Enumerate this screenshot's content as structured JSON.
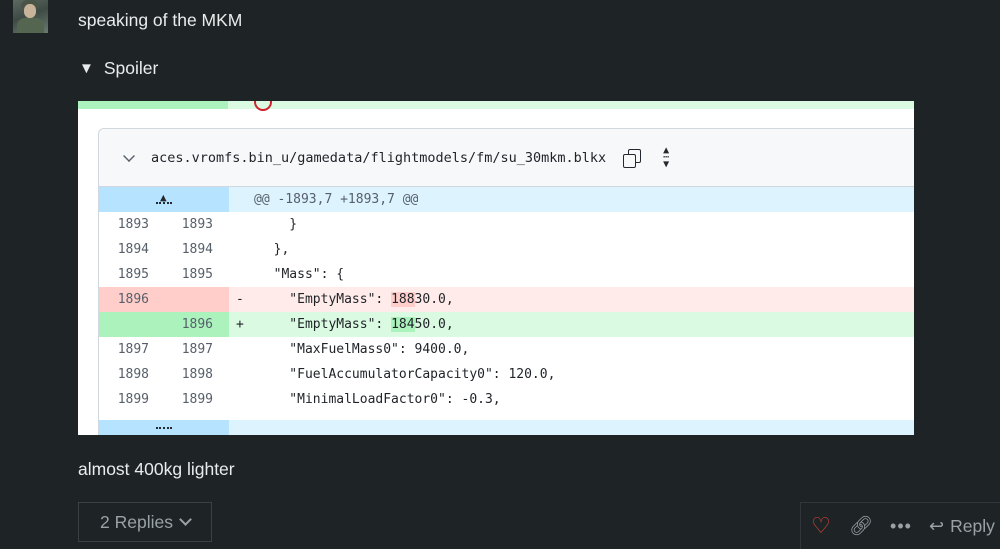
{
  "post": {
    "text1": "speaking of the MKM",
    "spoiler_label": "Spoiler",
    "text2": "almost 400kg lighter"
  },
  "diff": {
    "file_path": "aces.vromfs.bin_u/gamedata/flightmodels/fm/su_30mkm.blkx",
    "hunk_header": "@@ -1893,7 +1893,7 @@",
    "lines": [
      {
        "old": "1893",
        "new": "1893",
        "marker": "",
        "code": "    }",
        "type": "context"
      },
      {
        "old": "1894",
        "new": "1894",
        "marker": "",
        "code": "  },",
        "type": "context"
      },
      {
        "old": "1895",
        "new": "1895",
        "marker": "",
        "code": "  \"Mass\": {",
        "type": "context"
      },
      {
        "old": "1896",
        "new": "",
        "marker": "-",
        "code_pre": "    \"EmptyMass\": ",
        "code_hl": "188",
        "code_post": "30.0,",
        "type": "del"
      },
      {
        "old": "",
        "new": "1896",
        "marker": "+",
        "code_pre": "    \"EmptyMass\": ",
        "code_hl": "184",
        "code_post": "50.0,",
        "type": "add"
      },
      {
        "old": "1897",
        "new": "1897",
        "marker": "",
        "code": "    \"MaxFuelMass0\": 9400.0,",
        "type": "context"
      },
      {
        "old": "1898",
        "new": "1898",
        "marker": "",
        "code": "    \"FuelAccumulatorCapacity0\": 120.0,",
        "type": "context"
      },
      {
        "old": "1899",
        "new": "1899",
        "marker": "",
        "code": "    \"MinimalLoadFactor0\": -0.3,",
        "type": "context"
      }
    ]
  },
  "footer": {
    "replies_label": "2 Replies",
    "reply_label": "Reply"
  },
  "colors": {
    "background": "#1e2326",
    "like": "#e0443c",
    "muted": "#9aa2a6"
  }
}
